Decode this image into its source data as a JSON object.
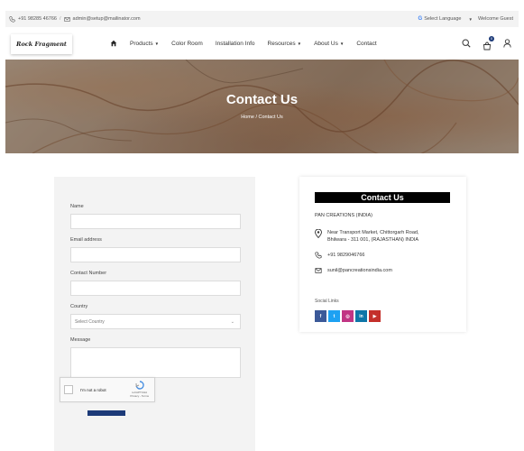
{
  "topbar": {
    "phone": "+91 98285 46766",
    "separator": "/",
    "email": "admin@setup@mailinator.com",
    "select_language": "Select Language",
    "welcome": "Welcome Guest"
  },
  "nav": {
    "logo_text": "Rock Fragment",
    "items": [
      {
        "label": "Products",
        "dropdown": true
      },
      {
        "label": "Color Room",
        "dropdown": false
      },
      {
        "label": "Installation Info",
        "dropdown": false
      },
      {
        "label": "Resources",
        "dropdown": true
      },
      {
        "label": "About Us",
        "dropdown": true
      },
      {
        "label": "Contact",
        "dropdown": false
      }
    ],
    "cart_count": "0",
    "icons": [
      "home-icon",
      "search-icon",
      "cart-icon",
      "user-icon"
    ]
  },
  "banner": {
    "title": "Contact Us",
    "breadcrumb_home": "Home",
    "breadcrumb_sep": "/",
    "breadcrumb_current": "Contact Us"
  },
  "form": {
    "name_label": "Name",
    "email_label": "Email address",
    "contact_label": "Contact Number",
    "country_label": "Country",
    "country_value": "Select Country",
    "message_label": "Message",
    "recaptcha_label": "I'm not a robot",
    "recaptcha_brand": "reCAPTCHA",
    "recaptcha_links": "Privacy - Terms"
  },
  "contact": {
    "title": "Contact Us",
    "company": "PAN CREATIONS (INDIA)",
    "address_line1": "Near Transport Market, Chittorgarh Road,",
    "address_line2": "Bhilwara - 311 001, (RAJASTHAN) INDIA",
    "phone": "+91 9829046766",
    "email": "sunil@pancreationsindia.com",
    "social_label": "Social Links",
    "socials": [
      {
        "name": "facebook",
        "glyph": "f",
        "color": "#3b5998"
      },
      {
        "name": "twitter",
        "glyph": "t",
        "color": "#1da1f2"
      },
      {
        "name": "instagram",
        "glyph": "◎",
        "color": "#c13584"
      },
      {
        "name": "linkedin",
        "glyph": "in",
        "color": "#0e76a8"
      },
      {
        "name": "youtube",
        "glyph": "▶",
        "color": "#c4302b"
      }
    ]
  },
  "colors": {
    "accent": "#1c3a78",
    "topbar_bg": "#f3f3f3",
    "form_bg": "#f3f3f3"
  }
}
